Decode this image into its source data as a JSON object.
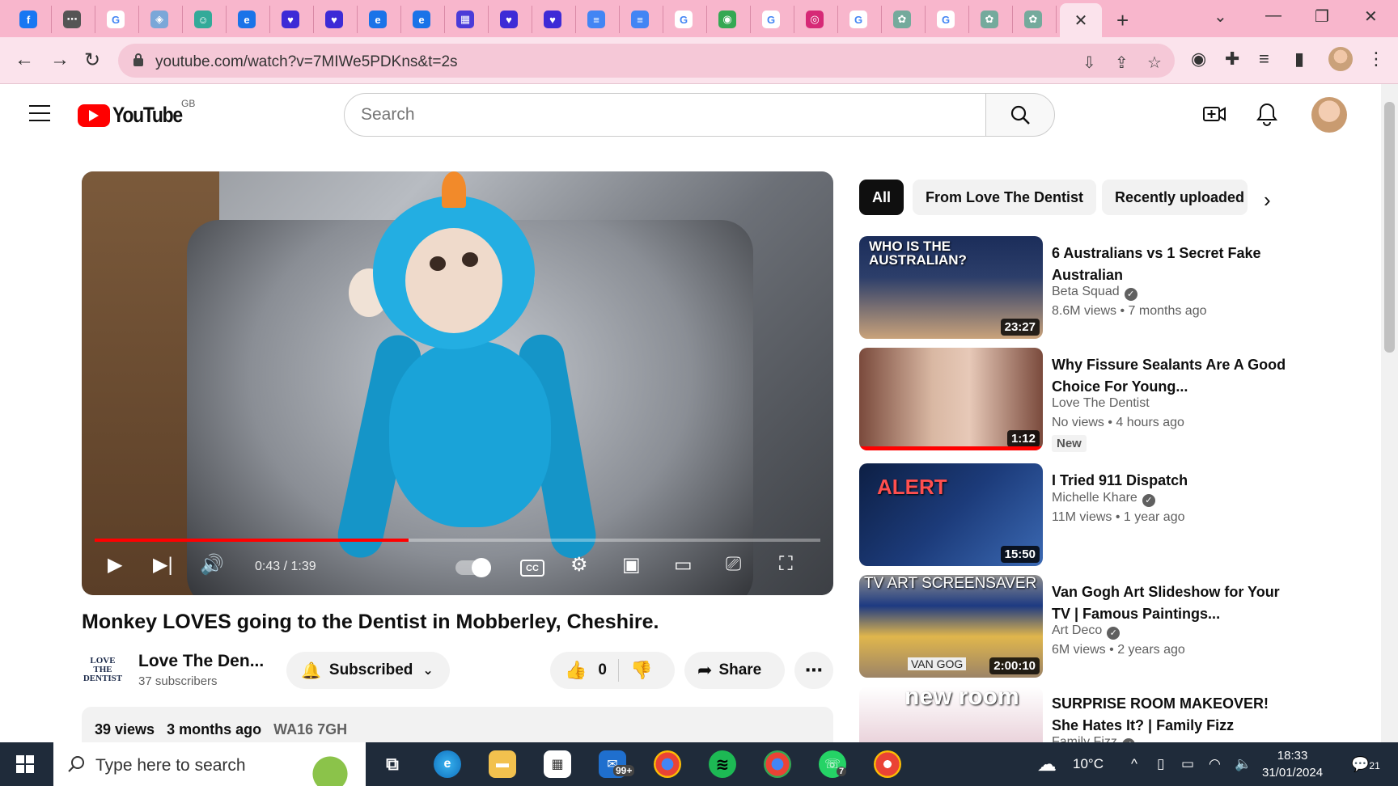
{
  "browser": {
    "tab_favicons": [
      "facebook",
      "dots",
      "google",
      "ext",
      "cat",
      "edge",
      "heart",
      "heart",
      "edge",
      "edge",
      "calendar",
      "heart",
      "heart",
      "docs",
      "docs",
      "google",
      "maps",
      "google",
      "instagram",
      "google",
      "chatgpt",
      "google",
      "chatgpt",
      "chatgpt"
    ],
    "active_tab_close": "✕",
    "new_tab": "+",
    "url": "youtube.com/watch?v=7MIWe5PDKns&t=2s"
  },
  "masthead": {
    "logo_text": "YouTube",
    "region": "GB",
    "search_placeholder": "Search"
  },
  "player": {
    "time": "0:43 / 1:39",
    "progress": 0.433,
    "cc_label": "CC"
  },
  "video": {
    "title": "Monkey LOVES going to the Dentist in Mobberley, Cheshire.",
    "channel_logo_line1": "LOVE",
    "channel_logo_line2": "THE",
    "channel_logo_line3": "DENTIST",
    "channel_name": "Love The Den...",
    "subscribers": "37 subscribers",
    "subscribed_label": "Subscribed",
    "likes": "0",
    "share_label": "Share",
    "views": "39 views",
    "age": "3 months ago",
    "location": "WA16 7GH"
  },
  "chips": [
    "All",
    "From Love The Dentist",
    "Recently uploaded"
  ],
  "recommendations": [
    {
      "title": "6 Australians vs 1 Secret Fake Australian",
      "channel": "Beta Squad",
      "verified": true,
      "views": "8.6M views",
      "age": "7 months ago",
      "duration": "23:27",
      "thumb_text": "WHO IS THE AUSTRALIAN?"
    },
    {
      "title": "Why Fissure Sealants Are A Good Choice For Young...",
      "channel": "Love The Dentist",
      "verified": false,
      "views": "No views",
      "age": "4 hours ago",
      "duration": "1:12",
      "badge": "New"
    },
    {
      "title": "I Tried 911 Dispatch",
      "channel": "Michelle Khare",
      "verified": true,
      "views": "11M views",
      "age": "1 year ago",
      "duration": "15:50",
      "thumb_text": "ALERT"
    },
    {
      "title": "Van Gogh Art Slideshow for Your TV | Famous Paintings...",
      "channel": "Art Deco",
      "verified": true,
      "views": "6M views",
      "age": "2 years ago",
      "duration": "2:00:10",
      "thumb_text": "TV ART SCREENSAVER",
      "thumb_text2": "VAN GOG"
    },
    {
      "title": "SURPRISE ROOM MAKEOVER! She Hates It? | Family Fizz",
      "channel": "Family Fizz",
      "verified": true,
      "thumb_text": "new room"
    }
  ],
  "taskbar": {
    "search_placeholder": "Type here to search",
    "mail_badge": "99+",
    "whatsapp_badge": "7",
    "weather": "10°C",
    "time": "18:33",
    "date": "31/01/2024",
    "notification_count": "21"
  }
}
